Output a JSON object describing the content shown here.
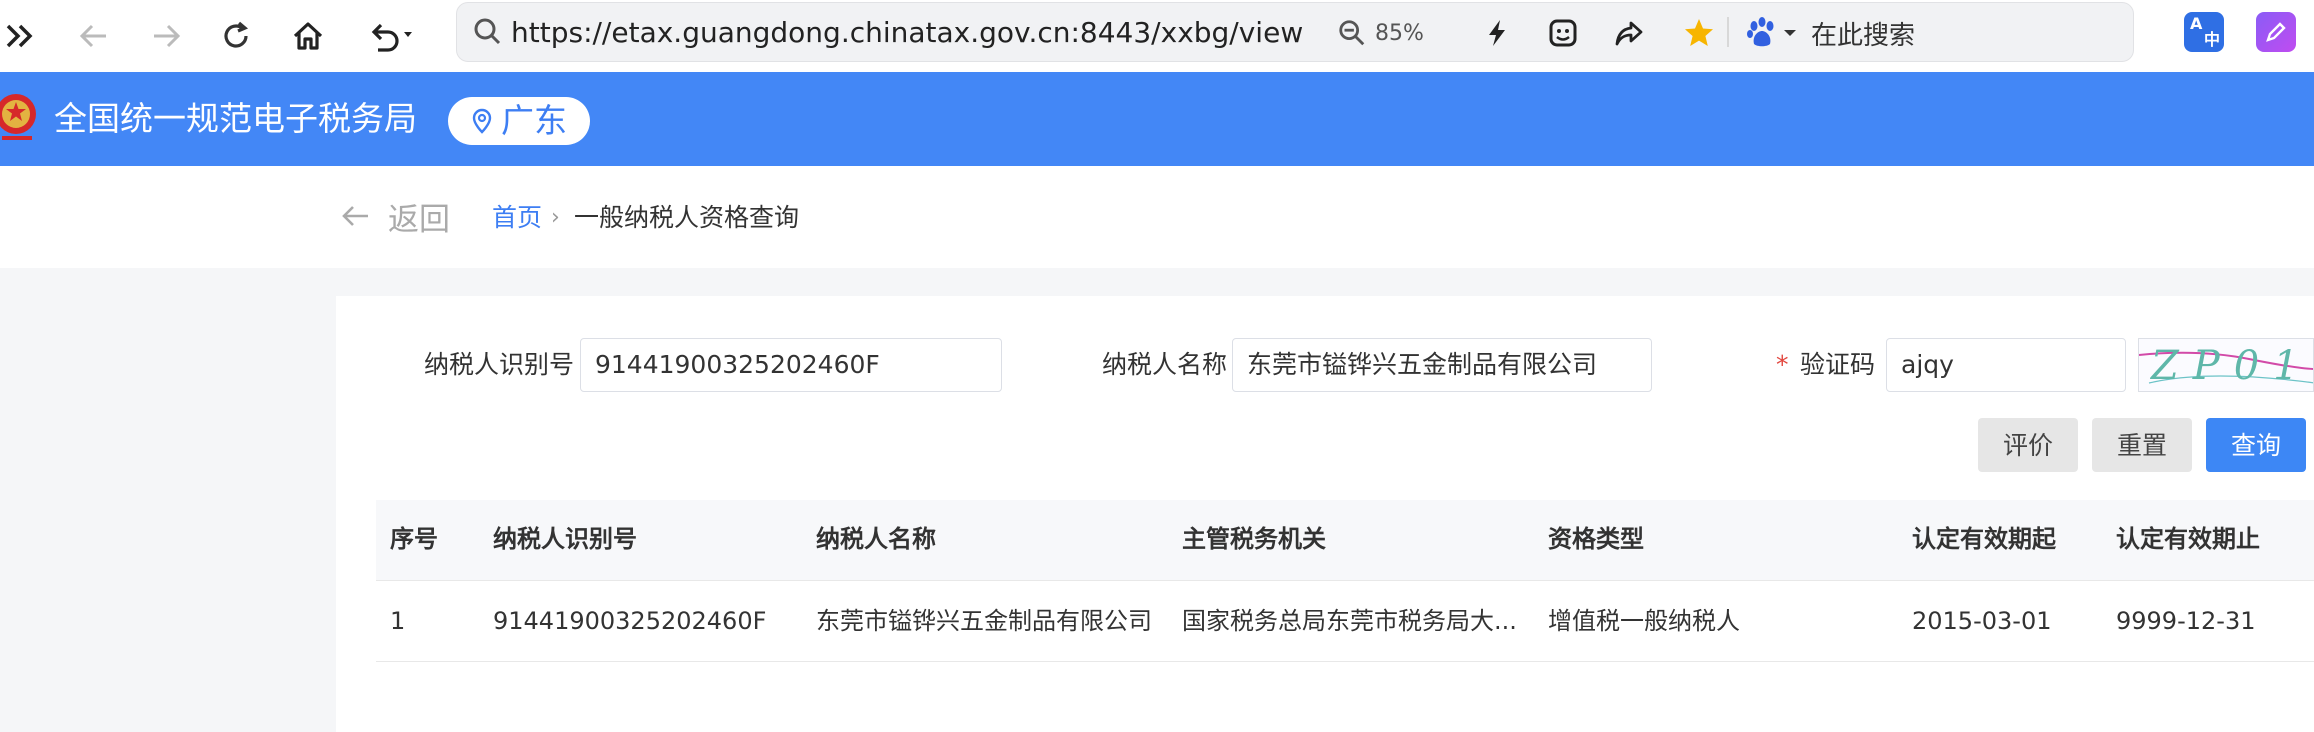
{
  "browser": {
    "url": "https://etax.guangdong.chinatax.gov.cn:8443/xxbg/view",
    "zoom": "85%",
    "search_placeholder": "在此搜索",
    "extension_badge": "中",
    "extension_badge_alt": "A"
  },
  "header": {
    "site_title": "全国统一规范电子税务局",
    "region": "广东"
  },
  "breadcrumb": {
    "back": "返回",
    "home": "首页",
    "separator": "›",
    "current": "一般纳税人资格查询"
  },
  "form": {
    "taxpayer_id_label": "纳税人识别号",
    "taxpayer_id_value": "91441900325202460F",
    "taxpayer_name_label": "纳税人名称",
    "taxpayer_name_value": "东莞市镒铧兴五金制品有限公司",
    "required_mark": "*",
    "captcha_label": "验证码",
    "captcha_value": "ajqy",
    "captcha_image_text": "ZP01"
  },
  "buttons": {
    "evaluate": "评价",
    "reset": "重置",
    "query": "查询"
  },
  "table": {
    "columns": [
      "序号",
      "纳税人识别号",
      "纳税人名称",
      "主管税务机关",
      "资格类型",
      "认定有效期起",
      "认定有效期止"
    ],
    "rows": [
      [
        "1",
        "91441900325202460F",
        "东莞市镒铧兴五金制品有限公司",
        "国家税务总局东莞市税务局大...",
        "增值税一般纳税人",
        "2015-03-01",
        "9999-12-31"
      ]
    ]
  },
  "colors": {
    "header_blue": "#4387f6",
    "link_blue": "#3d7ef3",
    "primary_button": "#3d87f5",
    "required_red": "#e2463e"
  }
}
